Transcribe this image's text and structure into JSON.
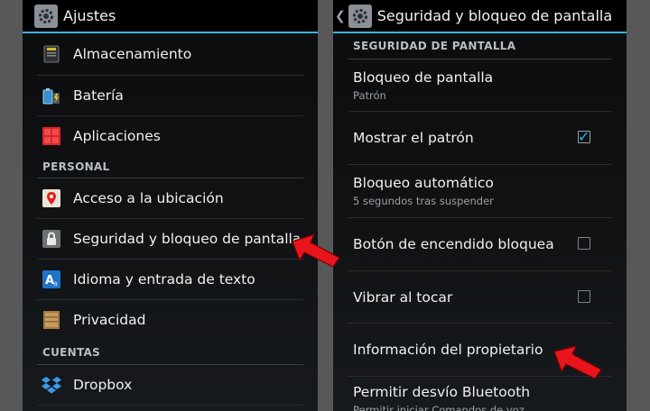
{
  "left_screen": {
    "title": "Ajustes",
    "items_top": [
      {
        "label": "Almacenamiento",
        "icon": "storage-icon"
      },
      {
        "label": "Batería",
        "icon": "battery-icon"
      },
      {
        "label": "Aplicaciones",
        "icon": "apps-icon"
      }
    ],
    "section_personal": "PERSONAL",
    "items_personal": [
      {
        "label": "Acceso a la ubicación",
        "icon": "location-icon"
      },
      {
        "label": "Seguridad y bloqueo de pantalla",
        "icon": "lock-icon"
      },
      {
        "label": "Idioma y entrada de texto",
        "icon": "language-icon"
      },
      {
        "label": "Privacidad",
        "icon": "privacy-icon"
      }
    ],
    "section_accounts": "CUENTAS",
    "items_accounts": [
      {
        "label": "Dropbox",
        "icon": "dropbox-icon"
      }
    ]
  },
  "right_screen": {
    "title": "Seguridad y bloqueo de pantalla",
    "section": "SEGURIDAD DE PANTALLA",
    "items": [
      {
        "title": "Bloqueo de pantalla",
        "subtitle": "Patrón"
      },
      {
        "title": "Mostrar el patrón",
        "checked": true
      },
      {
        "title": "Bloqueo automático",
        "subtitle": "5 segundos tras suspender"
      },
      {
        "title": "Botón de encendido bloquea",
        "checked": false
      },
      {
        "title": "Vibrar al tocar",
        "checked": false
      },
      {
        "title": "Información del propietario"
      },
      {
        "title": "Permitir desvío Bluetooth",
        "subtitle": "Permitir iniciar Comandos de voz"
      }
    ]
  },
  "colors": {
    "accent": "#33b5e5",
    "annotation_arrow": "#e8161c"
  }
}
